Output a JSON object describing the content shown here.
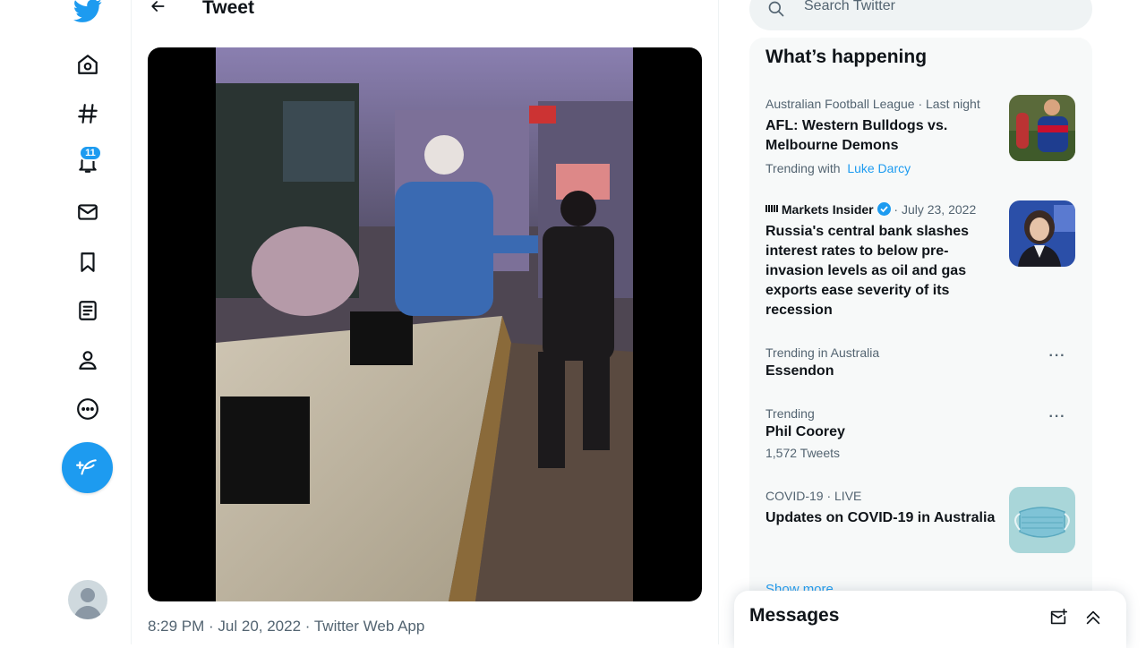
{
  "nav": {
    "notification_count": "11"
  },
  "header": {
    "title": "Tweet"
  },
  "tweet": {
    "timestamp": "8:29 PM · Jul 20, 2022 · Twitter Web App"
  },
  "search": {
    "placeholder": "Search Twitter"
  },
  "trends": {
    "title": "What’s happening",
    "items": [
      {
        "meta": "Australian Football League · Last night",
        "headline": "AFL: Western Bulldogs vs. Melbourne Demons",
        "trending_with_label": "Trending with",
        "trending_with_link": "Luke Darcy"
      },
      {
        "source": "Markets Insider",
        "date": "· July 23, 2022",
        "headline": "Russia's central bank slashes interest rates to below pre-invasion levels as oil and gas exports ease severity of its recession"
      },
      {
        "meta": "Trending in Australia",
        "headline": "Essendon"
      },
      {
        "meta": "Trending",
        "headline": "Phil Coorey",
        "count": "1,572 Tweets"
      },
      {
        "meta": "COVID-19 · LIVE",
        "headline": "Updates on COVID-19 in Australia"
      }
    ],
    "show_more": "Show more"
  },
  "messages": {
    "title": "Messages"
  },
  "colors": {
    "accent": "#1d9bf0",
    "text": "#0f1419",
    "muted": "#536471"
  }
}
